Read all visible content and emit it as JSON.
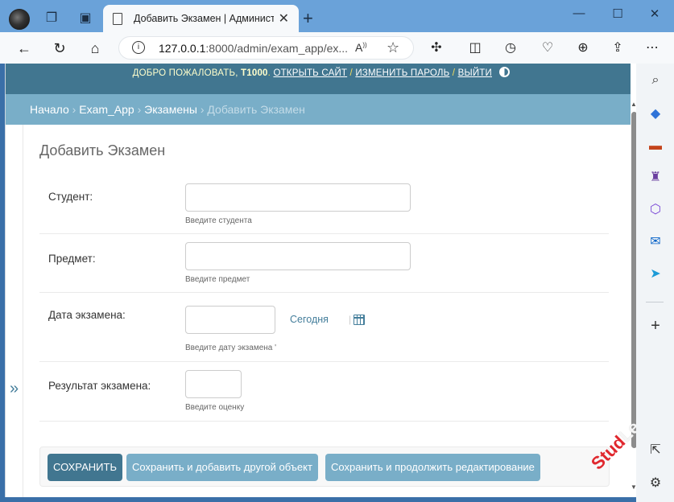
{
  "browser": {
    "tab_title": "Добавить Экзамен | Администр",
    "tab_close": "✕",
    "new_tab": "+",
    "address_host": "127.0.0.1",
    "address_rest": ":8000/admin/exam_app/ex..."
  },
  "site": {
    "welcome": "ДОБРО ПОЖАЛОВАТЬ, ",
    "username": "T1000",
    "view_site": "ОТКРЫТЬ САЙТ",
    "change_password": "ИЗМЕНИТЬ ПАРОЛЬ",
    "logout": "ВЫЙТИ",
    "sep": " / "
  },
  "breadcrumbs": {
    "home": "Начало",
    "app": "Exam_App",
    "model": "Экзамены",
    "current": "Добавить Экзамен",
    "sep": "›"
  },
  "sidebar_toggle": "»",
  "form": {
    "title": "Добавить Экзамен",
    "fields": {
      "student": {
        "label": "Студент:",
        "help": "Введите студента",
        "value": ""
      },
      "subject": {
        "label": "Предмет:",
        "help": "Введите предмет",
        "value": ""
      },
      "date": {
        "label": "Дата экзамена:",
        "help": "Введите дату экзамена '",
        "value": "",
        "today": "Сегодня",
        "sep": "|"
      },
      "result": {
        "label": "Результат экзамена:",
        "help": "Введите оценку",
        "value": ""
      }
    },
    "buttons": {
      "save": "СОХРАНИТЬ",
      "save_add_another": "Сохранить и добавить другой объект",
      "save_continue": "Сохранить и продолжить редактирование"
    }
  },
  "watermark": {
    "red": "Stud",
    "light": "Learn"
  },
  "colors": {
    "header": "#417690",
    "breadcrumbs": "#79aec8",
    "primary_button": "#417690",
    "secondary_button": "#79aec8"
  }
}
